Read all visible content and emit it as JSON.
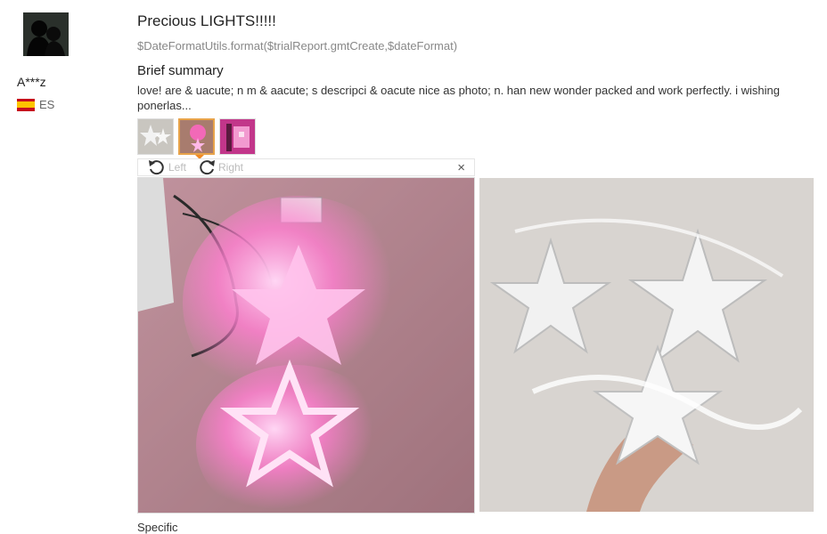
{
  "reviewer": {
    "name": "A***z",
    "country_code": "ES"
  },
  "review": {
    "title": "Precious LIGHTS!!!!!",
    "date_text": "$DateFormatUtils.format($trialReport.gmtCreate,$dateFormat)",
    "summary_heading": "Brief summary",
    "summary_text": "love! are & uacute; n m & aacute; s descripci & oacute nice as photo; n. han new wonder packed and work perfectly. i wishing ponerlas...",
    "next_heading_partial": "Specific"
  },
  "viewer": {
    "rotate_left_label": "Left",
    "rotate_right_label": "Right",
    "close_glyph": "×",
    "thumbnails": [
      "thumb-white-stars",
      "thumb-pink-lights",
      "thumb-pink-box"
    ],
    "active_thumbnail": 1
  },
  "colors": {
    "accent": "#f08a24",
    "flag_red": "#c60b1e",
    "flag_yellow": "#ffc400"
  }
}
